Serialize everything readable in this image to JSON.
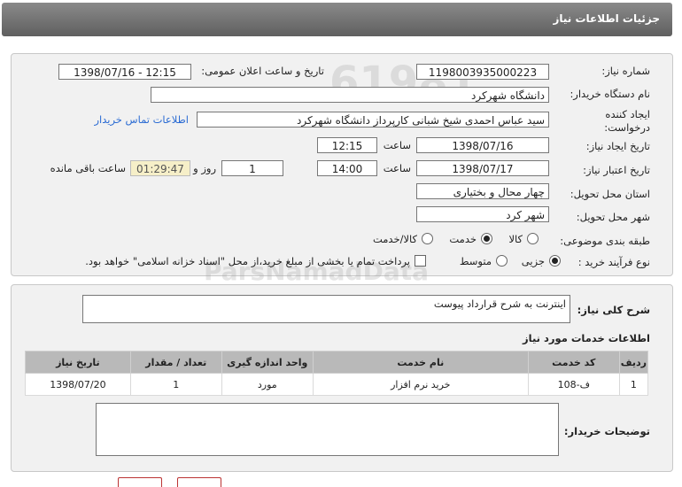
{
  "window": {
    "title": "جزئیات اطلاعات نیاز"
  },
  "form": {
    "need_number_label": "شماره نیاز:",
    "need_number": "1198003935000223",
    "announce_label": "تاریخ و ساعت اعلان عمومی:",
    "announce_value": "1398/07/16 - 12:15",
    "buyer_org_label": "نام دستگاه خریدار:",
    "buyer_org": "دانشگاه شهرکرد",
    "creator_label_1": "ایجاد کننده",
    "creator_label_2": "درخواست:",
    "creator": "سید عباس احمدی شیخ شبانی کارپرداز دانشگاه شهرکرد",
    "contact_link": "اطلاعات تماس خریدار",
    "created_label": "تاریخ ایجاد نیاز:",
    "created_date": "1398/07/16",
    "time_label": "ساعت",
    "created_time": "12:15",
    "validity_label": "تاریخ اعتبار نیاز:",
    "validity_date": "1398/07/17",
    "validity_time": "14:00",
    "days_value": "1",
    "days_label": "روز و",
    "remaining_time": "01:29:47",
    "remaining_label": "ساعت باقی مانده",
    "province_label": "استان محل تحویل:",
    "province": "چهار محال و بختیاری",
    "city_label": "شهر محل تحویل:",
    "city": "شهر کرد",
    "category_label": "طبقه بندی موضوعی:",
    "category_options": [
      "کالا",
      "خدمت",
      "کالا/خدمت"
    ],
    "category_selected": "خدمت",
    "process_label": "نوع فرآیند خرید :",
    "process_options": [
      "جزیی",
      "متوسط"
    ],
    "process_selected": "جزیی",
    "payment_note": "پرداخت تمام یا بخشی از مبلغ خرید،از محل \"اسناد خزانه اسلامی\" خواهد بود."
  },
  "description": {
    "label": "شرح کلی نیاز:",
    "text": "اینترنت به شرح قرارداد پیوست"
  },
  "services": {
    "heading": "اطلاعات خدمات مورد نیاز",
    "columns": [
      "ردیف",
      "کد خدمت",
      "نام خدمت",
      "واحد اندازه گیری",
      "تعداد / مقدار",
      "تاریخ نیاز"
    ],
    "rows": [
      [
        "1",
        "ف-108",
        "خرید نرم افزار",
        "مورد",
        "1",
        "1398/07/20"
      ]
    ]
  },
  "buyer_notes": {
    "label": "توضیحات خریدار:",
    "text": ""
  },
  "watermark": {
    "brand": "ParsNamadData",
    "line1": "مرکز فراوری اطلاعات پارس نماد داده ها",
    "line2": "پایگاه اطلاع رسانی مناقصه و مزایده",
    "phone": "۰۲۱-۸۸۳۴۹۶۷۰-۵",
    "number": "61981"
  }
}
